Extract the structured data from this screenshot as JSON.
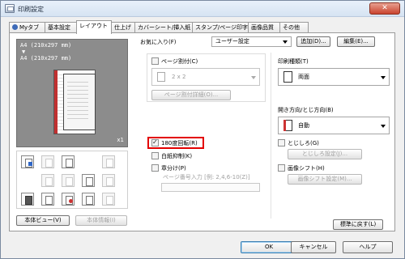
{
  "window": {
    "title": "印刷設定",
    "close_glyph": "✕"
  },
  "tabs": [
    {
      "label": "Myタブ"
    },
    {
      "label": "基本設定"
    },
    {
      "label": "レイアウト"
    },
    {
      "label": "仕上げ"
    },
    {
      "label": "カバーシート/挿入紙"
    },
    {
      "label": "スタンプ/ページ印字"
    },
    {
      "label": "画像品質"
    },
    {
      "label": "その他"
    }
  ],
  "active_tab": "レイアウト",
  "preview": {
    "paper_line1": "A4 (210x297 mm)",
    "arrow": "▼",
    "paper_line2": "A4 (210x297 mm)",
    "copies": "x1"
  },
  "left_buttons": {
    "printer_view": "本体ビュー(V)",
    "printer_info": "本体情報(I)"
  },
  "favorites": {
    "label": "お気に入り(F)",
    "value": "ユーザー設定",
    "add": "追加(D)...",
    "edit": "編集(E)..."
  },
  "combination": {
    "label": "ページ割付(C)",
    "value": "2 x 2",
    "detail": "ページ割付詳細(O)...",
    "checked": false
  },
  "rotate180": {
    "label": "180度回転(R)",
    "checked": true
  },
  "skip_blank": {
    "label": "白紙抑制(K)",
    "checked": false
  },
  "chapters": {
    "label": "章分け(P)",
    "placeholder": "ページ番号入力 [例: 2,4,6-10(Z)]",
    "checked": false
  },
  "print_type": {
    "label": "印刷種類(T)",
    "value": "両面"
  },
  "binding": {
    "label": "開き方向/とじ方向(B)",
    "value": "自動"
  },
  "margin": {
    "label": "とじしろ(G)",
    "button": "とじしろ設定(J)...",
    "checked": false
  },
  "image_shift": {
    "label": "画像シフト(H)",
    "button": "画像シフト設定(M)...",
    "checked": false
  },
  "restore_defaults": "標準に戻す(L)",
  "footer": {
    "ok": "OK",
    "cancel": "キャンセル",
    "help": "ヘルプ"
  }
}
